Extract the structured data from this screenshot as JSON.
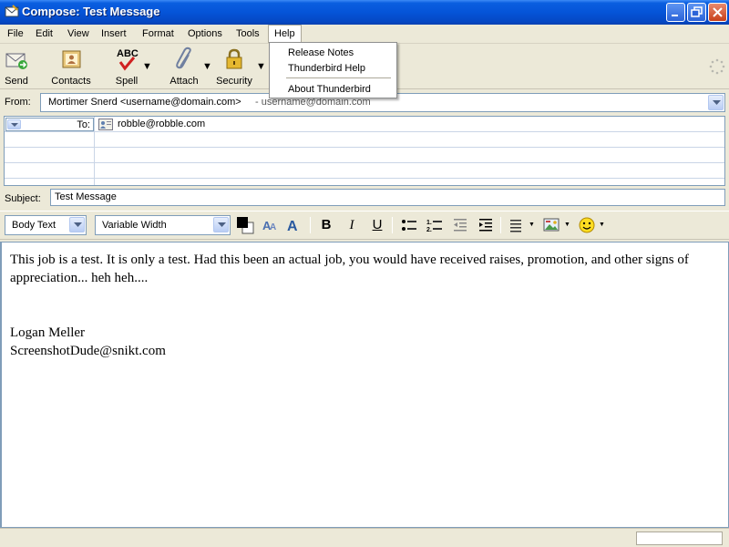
{
  "window": {
    "title": "Compose: Test Message"
  },
  "menubar": {
    "items": [
      "File",
      "Edit",
      "View",
      "Insert",
      "Format",
      "Options",
      "Tools",
      "Help"
    ]
  },
  "help_menu": {
    "items": [
      "Release Notes",
      "Thunderbird Help",
      "About Thunderbird"
    ]
  },
  "toolbar": {
    "send": "Send",
    "contacts": "Contacts",
    "spell": "Spell",
    "attach": "Attach",
    "security": "Security"
  },
  "header": {
    "from_label": "From:",
    "from_value": "Mortimer Snerd <username@domain.com>",
    "from_suffix": "- username@domain.com",
    "recipient_type": "To:",
    "recipient": "robble@robble.com",
    "subject_label": "Subject:",
    "subject_value": "Test Message"
  },
  "format_bar": {
    "paragraph_style": "Body Text",
    "font": "Variable Width",
    "bold": "B",
    "italic": "I",
    "underline": "U"
  },
  "body": {
    "lines": [
      "This job is a test.  It is only a test.  Had this been an actual job, you would have received raises, promotion, and other signs of",
      "appreciation... heh heh....",
      "",
      "",
      "Logan Meller",
      "ScreenshotDude@snikt.com"
    ]
  },
  "colors": {
    "titlebar": "#0554d8",
    "menu_bg": "#ece9d8",
    "border": "#7f9db9"
  }
}
